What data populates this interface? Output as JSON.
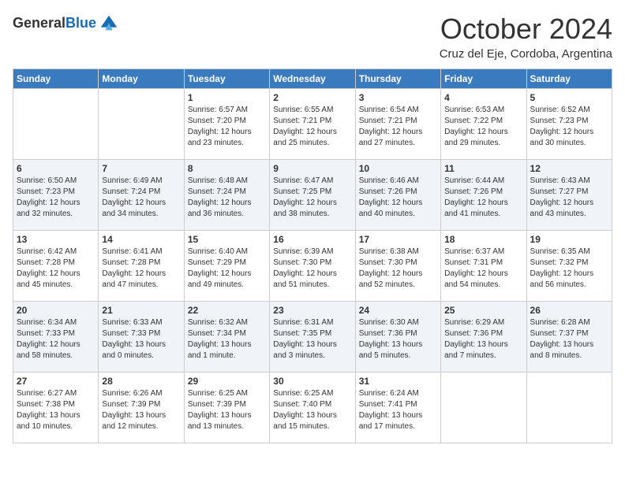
{
  "header": {
    "logo_general": "General",
    "logo_blue": "Blue",
    "month": "October 2024",
    "location": "Cruz del Eje, Cordoba, Argentina"
  },
  "days_of_week": [
    "Sunday",
    "Monday",
    "Tuesday",
    "Wednesday",
    "Thursday",
    "Friday",
    "Saturday"
  ],
  "weeks": [
    [
      {
        "day": "",
        "sunrise": "",
        "sunset": "",
        "daylight": ""
      },
      {
        "day": "",
        "sunrise": "",
        "sunset": "",
        "daylight": ""
      },
      {
        "day": "1",
        "sunrise": "Sunrise: 6:57 AM",
        "sunset": "Sunset: 7:20 PM",
        "daylight": "Daylight: 12 hours and 23 minutes."
      },
      {
        "day": "2",
        "sunrise": "Sunrise: 6:55 AM",
        "sunset": "Sunset: 7:21 PM",
        "daylight": "Daylight: 12 hours and 25 minutes."
      },
      {
        "day": "3",
        "sunrise": "Sunrise: 6:54 AM",
        "sunset": "Sunset: 7:21 PM",
        "daylight": "Daylight: 12 hours and 27 minutes."
      },
      {
        "day": "4",
        "sunrise": "Sunrise: 6:53 AM",
        "sunset": "Sunset: 7:22 PM",
        "daylight": "Daylight: 12 hours and 29 minutes."
      },
      {
        "day": "5",
        "sunrise": "Sunrise: 6:52 AM",
        "sunset": "Sunset: 7:23 PM",
        "daylight": "Daylight: 12 hours and 30 minutes."
      }
    ],
    [
      {
        "day": "6",
        "sunrise": "Sunrise: 6:50 AM",
        "sunset": "Sunset: 7:23 PM",
        "daylight": "Daylight: 12 hours and 32 minutes."
      },
      {
        "day": "7",
        "sunrise": "Sunrise: 6:49 AM",
        "sunset": "Sunset: 7:24 PM",
        "daylight": "Daylight: 12 hours and 34 minutes."
      },
      {
        "day": "8",
        "sunrise": "Sunrise: 6:48 AM",
        "sunset": "Sunset: 7:24 PM",
        "daylight": "Daylight: 12 hours and 36 minutes."
      },
      {
        "day": "9",
        "sunrise": "Sunrise: 6:47 AM",
        "sunset": "Sunset: 7:25 PM",
        "daylight": "Daylight: 12 hours and 38 minutes."
      },
      {
        "day": "10",
        "sunrise": "Sunrise: 6:46 AM",
        "sunset": "Sunset: 7:26 PM",
        "daylight": "Daylight: 12 hours and 40 minutes."
      },
      {
        "day": "11",
        "sunrise": "Sunrise: 6:44 AM",
        "sunset": "Sunset: 7:26 PM",
        "daylight": "Daylight: 12 hours and 41 minutes."
      },
      {
        "day": "12",
        "sunrise": "Sunrise: 6:43 AM",
        "sunset": "Sunset: 7:27 PM",
        "daylight": "Daylight: 12 hours and 43 minutes."
      }
    ],
    [
      {
        "day": "13",
        "sunrise": "Sunrise: 6:42 AM",
        "sunset": "Sunset: 7:28 PM",
        "daylight": "Daylight: 12 hours and 45 minutes."
      },
      {
        "day": "14",
        "sunrise": "Sunrise: 6:41 AM",
        "sunset": "Sunset: 7:28 PM",
        "daylight": "Daylight: 12 hours and 47 minutes."
      },
      {
        "day": "15",
        "sunrise": "Sunrise: 6:40 AM",
        "sunset": "Sunset: 7:29 PM",
        "daylight": "Daylight: 12 hours and 49 minutes."
      },
      {
        "day": "16",
        "sunrise": "Sunrise: 6:39 AM",
        "sunset": "Sunset: 7:30 PM",
        "daylight": "Daylight: 12 hours and 51 minutes."
      },
      {
        "day": "17",
        "sunrise": "Sunrise: 6:38 AM",
        "sunset": "Sunset: 7:30 PM",
        "daylight": "Daylight: 12 hours and 52 minutes."
      },
      {
        "day": "18",
        "sunrise": "Sunrise: 6:37 AM",
        "sunset": "Sunset: 7:31 PM",
        "daylight": "Daylight: 12 hours and 54 minutes."
      },
      {
        "day": "19",
        "sunrise": "Sunrise: 6:35 AM",
        "sunset": "Sunset: 7:32 PM",
        "daylight": "Daylight: 12 hours and 56 minutes."
      }
    ],
    [
      {
        "day": "20",
        "sunrise": "Sunrise: 6:34 AM",
        "sunset": "Sunset: 7:33 PM",
        "daylight": "Daylight: 12 hours and 58 minutes."
      },
      {
        "day": "21",
        "sunrise": "Sunrise: 6:33 AM",
        "sunset": "Sunset: 7:33 PM",
        "daylight": "Daylight: 13 hours and 0 minutes."
      },
      {
        "day": "22",
        "sunrise": "Sunrise: 6:32 AM",
        "sunset": "Sunset: 7:34 PM",
        "daylight": "Daylight: 13 hours and 1 minute."
      },
      {
        "day": "23",
        "sunrise": "Sunrise: 6:31 AM",
        "sunset": "Sunset: 7:35 PM",
        "daylight": "Daylight: 13 hours and 3 minutes."
      },
      {
        "day": "24",
        "sunrise": "Sunrise: 6:30 AM",
        "sunset": "Sunset: 7:36 PM",
        "daylight": "Daylight: 13 hours and 5 minutes."
      },
      {
        "day": "25",
        "sunrise": "Sunrise: 6:29 AM",
        "sunset": "Sunset: 7:36 PM",
        "daylight": "Daylight: 13 hours and 7 minutes."
      },
      {
        "day": "26",
        "sunrise": "Sunrise: 6:28 AM",
        "sunset": "Sunset: 7:37 PM",
        "daylight": "Daylight: 13 hours and 8 minutes."
      }
    ],
    [
      {
        "day": "27",
        "sunrise": "Sunrise: 6:27 AM",
        "sunset": "Sunset: 7:38 PM",
        "daylight": "Daylight: 13 hours and 10 minutes."
      },
      {
        "day": "28",
        "sunrise": "Sunrise: 6:26 AM",
        "sunset": "Sunset: 7:39 PM",
        "daylight": "Daylight: 13 hours and 12 minutes."
      },
      {
        "day": "29",
        "sunrise": "Sunrise: 6:25 AM",
        "sunset": "Sunset: 7:39 PM",
        "daylight": "Daylight: 13 hours and 13 minutes."
      },
      {
        "day": "30",
        "sunrise": "Sunrise: 6:25 AM",
        "sunset": "Sunset: 7:40 PM",
        "daylight": "Daylight: 13 hours and 15 minutes."
      },
      {
        "day": "31",
        "sunrise": "Sunrise: 6:24 AM",
        "sunset": "Sunset: 7:41 PM",
        "daylight": "Daylight: 13 hours and 17 minutes."
      },
      {
        "day": "",
        "sunrise": "",
        "sunset": "",
        "daylight": ""
      },
      {
        "day": "",
        "sunrise": "",
        "sunset": "",
        "daylight": ""
      }
    ]
  ]
}
